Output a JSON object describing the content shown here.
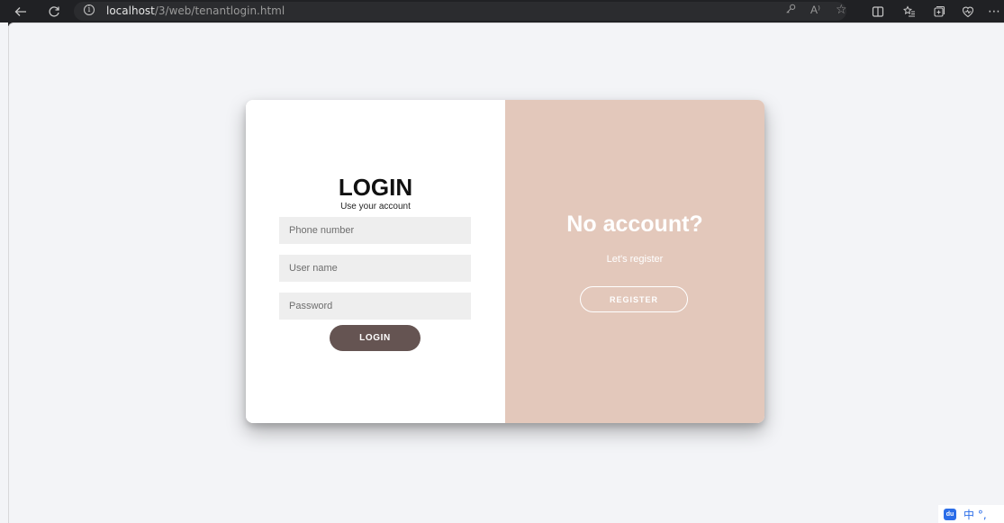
{
  "browser": {
    "url_host": "localhost",
    "url_path": "/3/web/tenantlogin.html",
    "read_aloud_label": "A⁾"
  },
  "login": {
    "title": "LOGIN",
    "subtitle": "Use your account",
    "phone_placeholder": "Phone number",
    "username_placeholder": "User name",
    "password_placeholder": "Password",
    "button_label": "LOGIN"
  },
  "register_panel": {
    "title": "No account?",
    "subtitle": "Let's register",
    "button_label": "REGISTER"
  },
  "ime": {
    "logo_text": "du",
    "mode_text": "中 °,"
  },
  "colors": {
    "accent_panel": "#e3c8bb",
    "login_button": "#655452",
    "page_background": "#f3f4f7"
  }
}
